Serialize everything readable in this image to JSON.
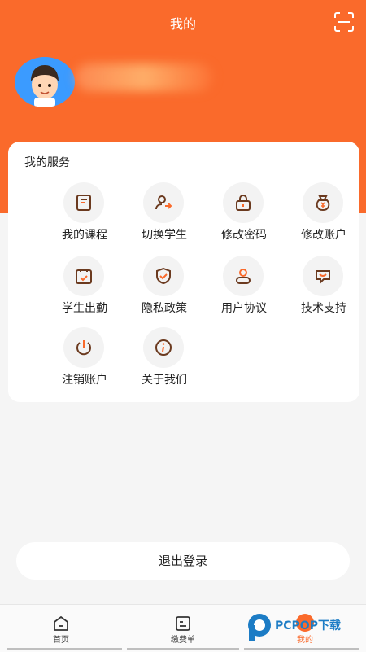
{
  "header": {
    "title": "我的"
  },
  "services": {
    "section_title": "我的服务",
    "items": [
      {
        "label": "我的课程",
        "icon": "book-icon"
      },
      {
        "label": "切换学生",
        "icon": "switch-user-icon"
      },
      {
        "label": "修改密码",
        "icon": "lock-icon"
      },
      {
        "label": "修改账户",
        "icon": "money-bag-icon"
      },
      {
        "label": "学生出勤",
        "icon": "calendar-check-icon"
      },
      {
        "label": "隐私政策",
        "icon": "shield-check-icon"
      },
      {
        "label": "用户协议",
        "icon": "user-icon"
      },
      {
        "label": "技术支持",
        "icon": "chat-icon"
      },
      {
        "label": "注销账户",
        "icon": "power-icon"
      },
      {
        "label": "关于我们",
        "icon": "info-icon"
      }
    ]
  },
  "logout": {
    "label": "退出登录"
  },
  "tabbar": {
    "items": [
      {
        "label": "首页",
        "icon": "home-icon"
      },
      {
        "label": "缴费单",
        "icon": "bill-icon"
      },
      {
        "label": "我的",
        "icon": "profile-icon"
      }
    ]
  },
  "watermark": {
    "brand": "PCPOP下载"
  },
  "colors": {
    "accent": "#fa6a2b",
    "icon_stroke": "#6b3a1f",
    "icon_accent": "#fa6a2b"
  }
}
